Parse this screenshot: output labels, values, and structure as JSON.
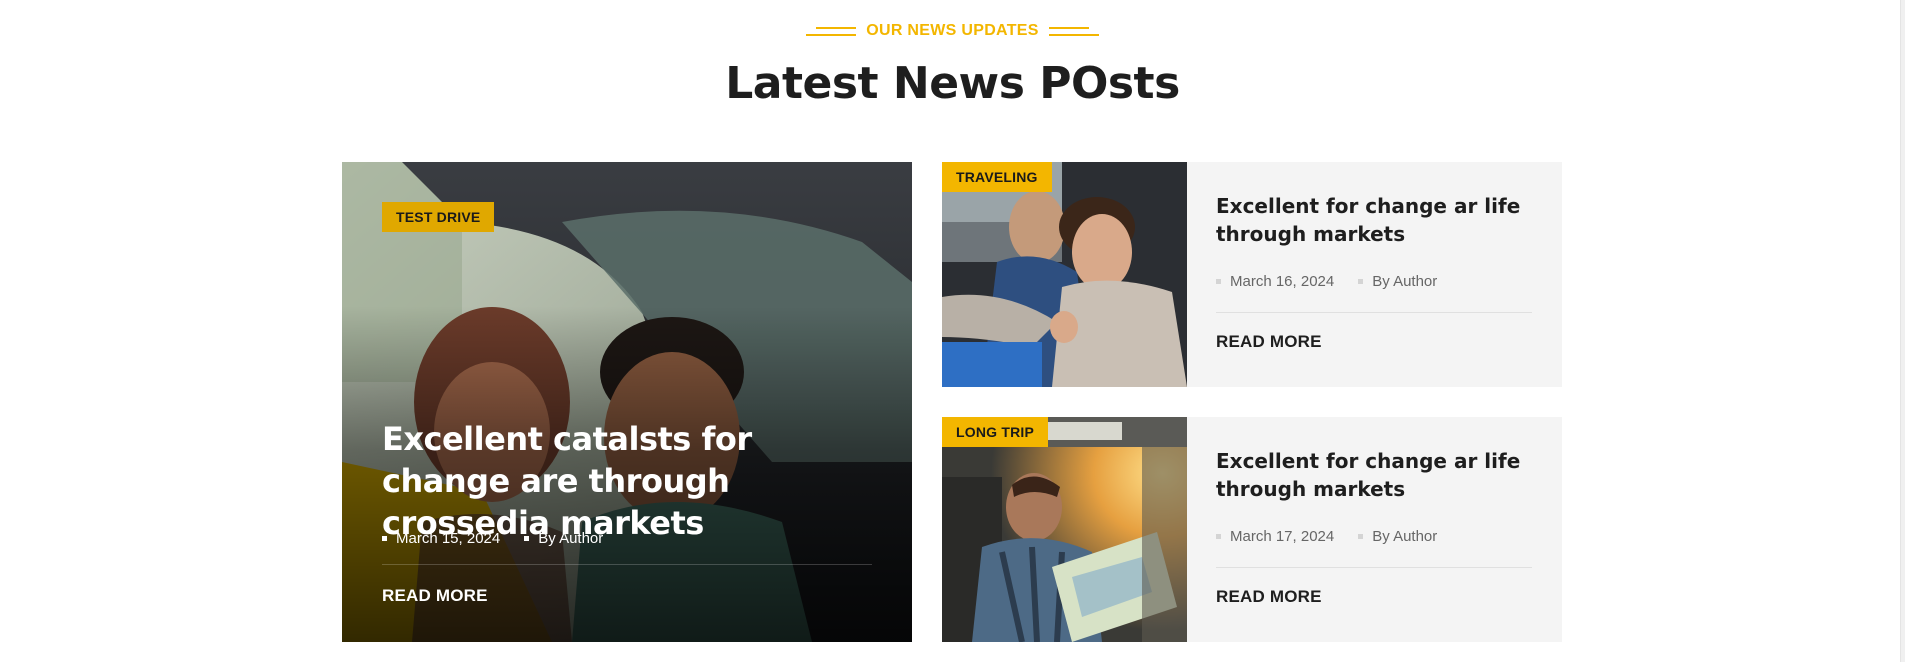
{
  "section": {
    "subtitle": "OUR NEWS UPDATES",
    "title": "Latest News POsts"
  },
  "featured_post": {
    "category": "TEST DRIVE",
    "title": "Excellent catalsts for change are through crossedia markets",
    "date": "March 15, 2024",
    "author": "By Author",
    "read_more": "READ MORE"
  },
  "posts": [
    {
      "category": "TRAVELING",
      "title": "Excellent for change ar life through markets",
      "date": "March 16, 2024",
      "author": "By Author",
      "read_more": "READ MORE"
    },
    {
      "category": "LONG TRIP",
      "title": "Excellent for change ar life through markets",
      "date": "March 17, 2024",
      "author": "By Author",
      "read_more": "READ MORE"
    }
  ],
  "colors": {
    "accent": "#f3b600",
    "heading": "#1e1e1e",
    "card_bg": "#f4f4f4"
  }
}
